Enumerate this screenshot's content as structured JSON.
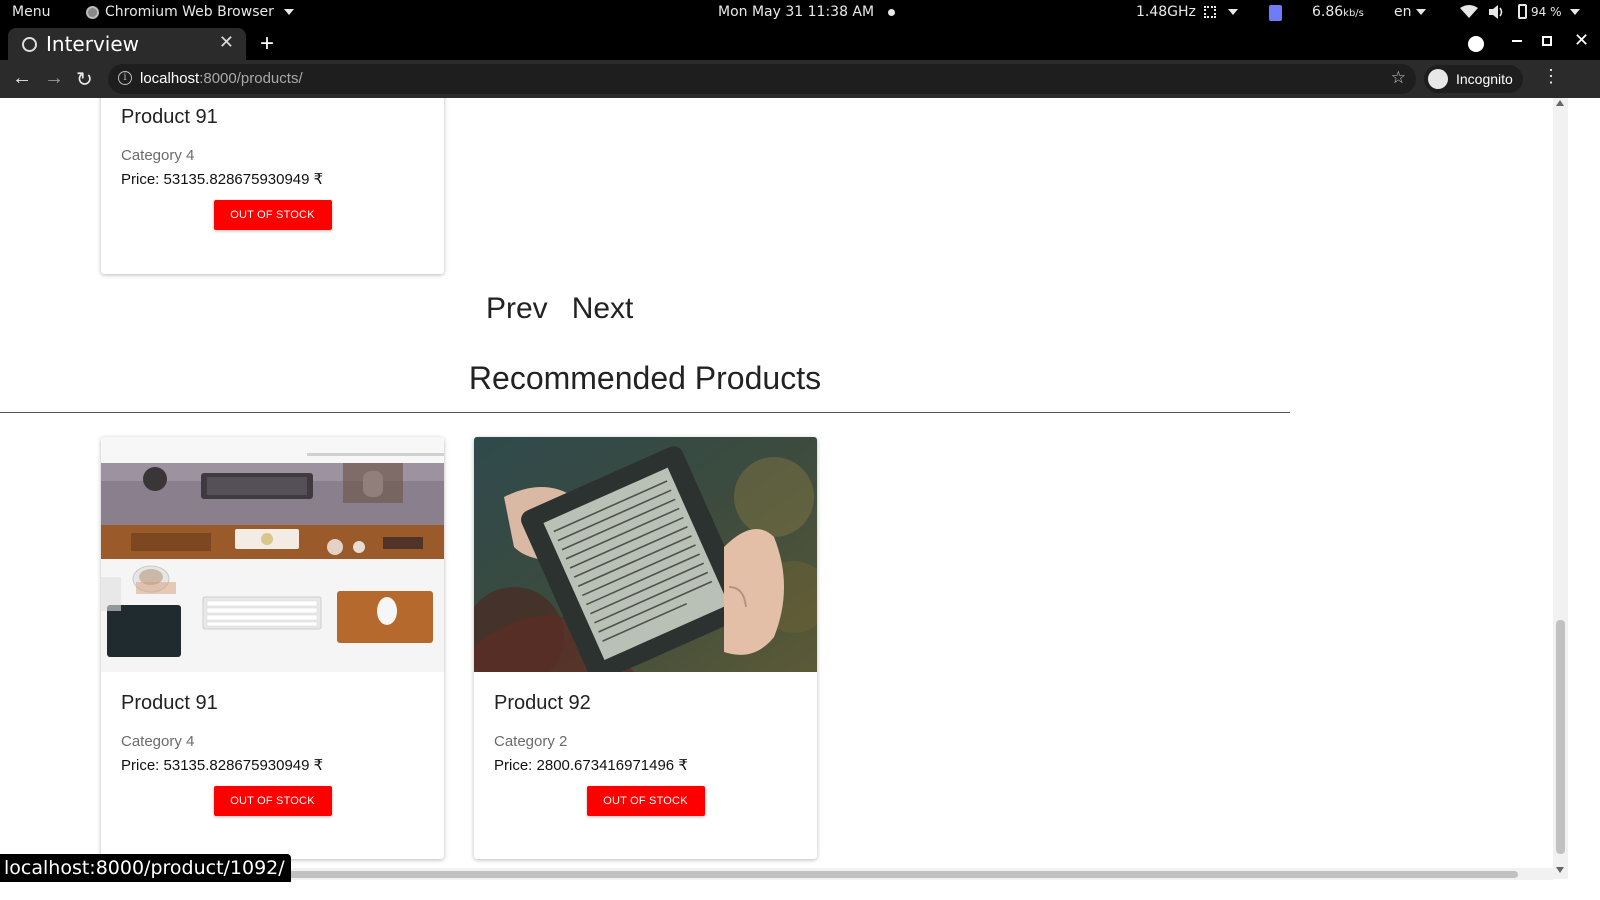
{
  "system_bar": {
    "menu": "Menu",
    "app_name": "Chromium Web Browser",
    "clock": "Mon May 31  11:38 AM",
    "cpu": "1.48GHz",
    "network_value": "6.86",
    "network_unit": "kb/s",
    "language": "en",
    "battery": "94 %"
  },
  "browser": {
    "tab_title": "Interview",
    "url_host": "localhost",
    "url_path": ":8000/products/",
    "incognito_label": "Incognito",
    "status_url": "localhost:8000/product/1092/"
  },
  "page": {
    "top_product": {
      "name": "Product 91",
      "category": "Category 4",
      "price": "Price: 53135.828675930949 ₹",
      "stock_button": "OUT OF STOCK"
    },
    "pagination": {
      "prev": "Prev",
      "next": "Next"
    },
    "recommended_heading": "Recommended Products",
    "recommended": [
      {
        "name": "Product 91",
        "category": "Category 4",
        "price": "Price: 53135.828675930949 ₹",
        "stock_button": "OUT OF STOCK",
        "image": "desk-workspace-photo"
      },
      {
        "name": "Product 92",
        "category": "Category 2",
        "price": "Price: 2800.673416971496 ₹",
        "stock_button": "OUT OF STOCK",
        "image": "kindle-ereader-photo"
      }
    ]
  },
  "colors": {
    "out_of_stock_button": "#ff0000",
    "browser_chrome": "#2b2b2b",
    "system_bar": "#000000"
  }
}
